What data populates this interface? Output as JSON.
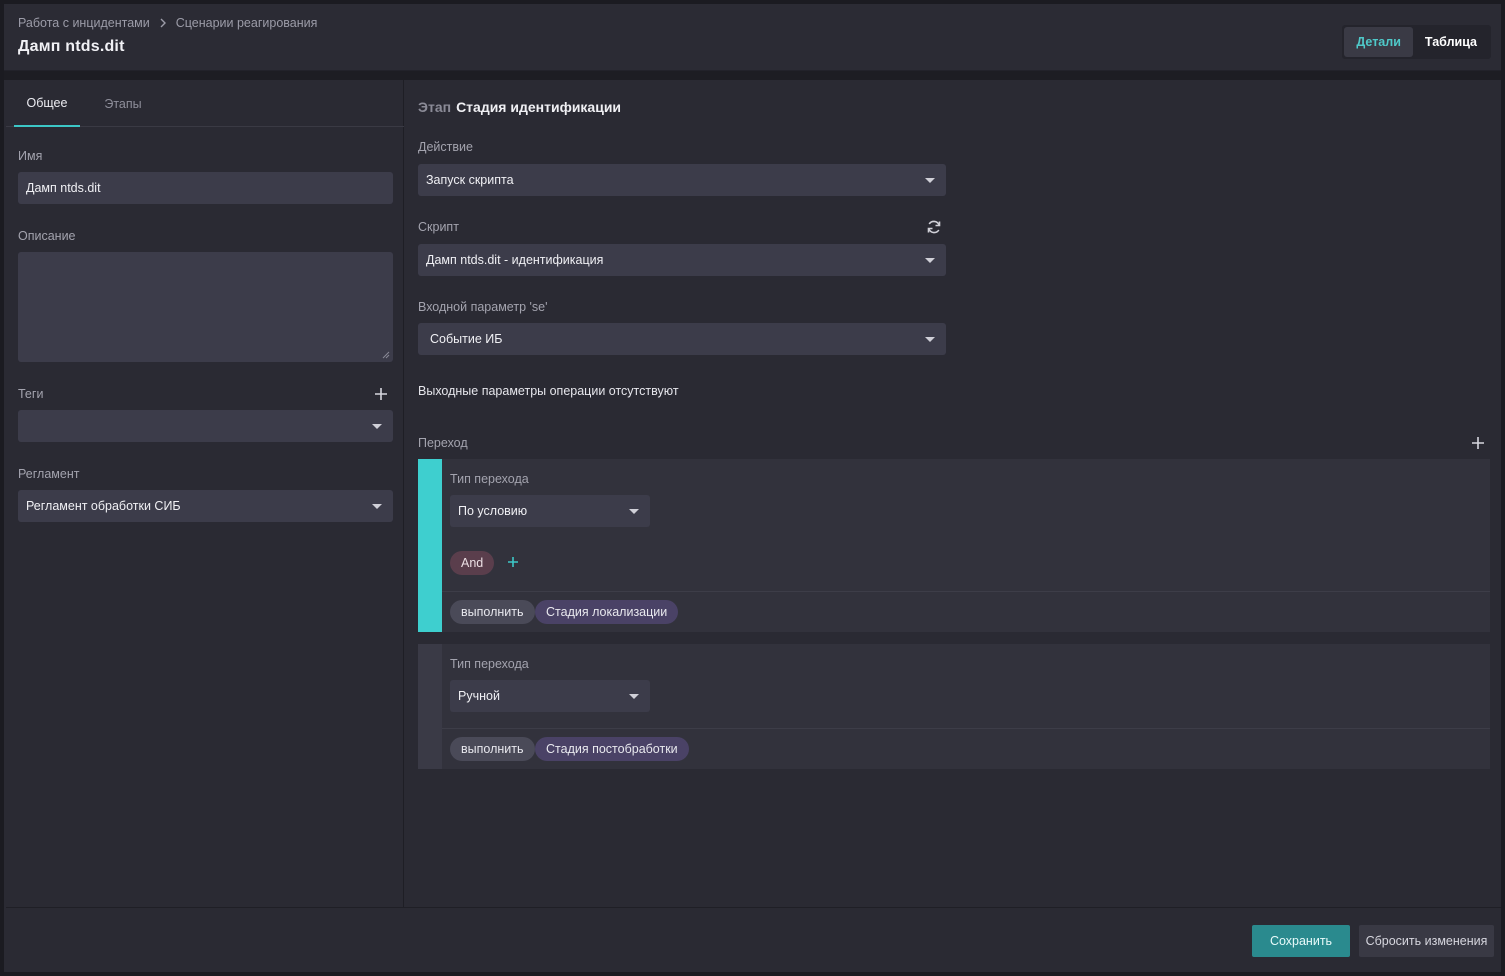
{
  "header": {
    "breadcrumb": [
      "Работа с инцидентами",
      "Сценарии реагирования"
    ],
    "title": "Дамп ntds.dit",
    "view_toggle": {
      "details": "Детали",
      "table": "Таблица"
    }
  },
  "left": {
    "tabs": {
      "general": "Общее",
      "stages": "Этапы"
    },
    "name_label": "Имя",
    "name_value": "Дамп ntds.dit",
    "description_label": "Описание",
    "description_value": "",
    "tags_label": "Теги",
    "tags_value": "",
    "regulation_label": "Регламент",
    "regulation_value": "Регламент обработки СИБ"
  },
  "right": {
    "stage_prefix": "Этап",
    "stage_name": "Стадия идентификации",
    "action_label": "Действие",
    "action_value": "Запуск скрипта",
    "script_label": "Скрипт",
    "script_value": "Дамп ntds.dit - идентификация",
    "input_param_label": "Входной параметр 'se'",
    "input_param_value": "Событие ИБ",
    "no_output_text": "Выходные параметры операции отсутствуют",
    "transition_label": "Переход",
    "transitions": [
      {
        "type_label": "Тип перехода",
        "type_value": "По условию",
        "operator": "And",
        "exec_label": "выполнить",
        "target": "Стадия локализации",
        "bar_color": "#3ecfcf"
      },
      {
        "type_label": "Тип перехода",
        "type_value": "Ручной",
        "exec_label": "выполнить",
        "target": "Стадия постобработки",
        "bar_color": "#3a3a46"
      }
    ]
  },
  "footer": {
    "save": "Сохранить",
    "reset": "Сбросить изменения"
  },
  "colors": {
    "accent": "#3cc7c7",
    "primary_button": "#2a8a8e"
  }
}
